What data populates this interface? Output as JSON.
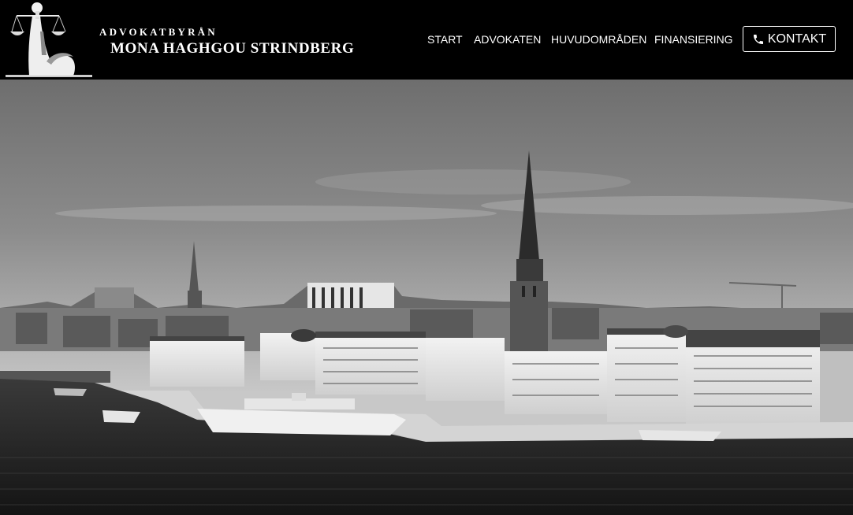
{
  "header": {
    "brand_top": "ADVOKATBYRÅN",
    "brand_name": "MONA HAGHGOU STRINDBERG",
    "logo_icon": "justitia-scales-icon"
  },
  "nav": {
    "start": "START",
    "advokaten": "ADVOKATEN",
    "huvudomraden": "HUVUDOMRÅDEN",
    "finansiering": "FINANSIERING",
    "kontakt": "KONTAKT",
    "kontakt_icon": "phone-icon"
  },
  "hero": {
    "image": "stockholm-skyline-black-and-white"
  },
  "colors": {
    "header_bg": "#000000",
    "text": "#ffffff"
  }
}
